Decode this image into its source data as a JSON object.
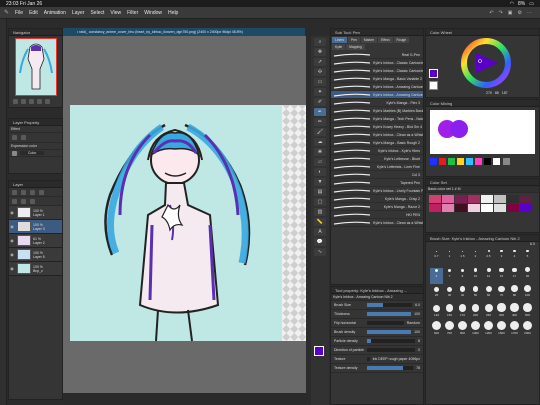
{
  "status": {
    "time": "23:03",
    "date": "Fri Jan 26",
    "battery": "8%"
  },
  "menu": [
    "File",
    "Edit",
    "Animation",
    "Layer",
    "Select",
    "View",
    "Filter",
    "Window",
    "Help"
  ],
  "doc_tab": "• raidi_ constancy_anime_cover_hhu (heart_by_kirboo_lionzen_dgn750.png) (2400 x 2400px 96dpi 48.8%)",
  "navigator": {
    "title": "Navigator"
  },
  "layer_property": {
    "title": "Layer Property",
    "effect": "Effect",
    "expression_color": "Expression color",
    "color_value": "Color"
  },
  "layers": {
    "title": "Layer",
    "items": [
      {
        "opacity": "100 %",
        "blend": "Normal",
        "name": "Layer 1"
      },
      {
        "opacity": "100 %",
        "blend": "Normal",
        "name": "Layer 3"
      },
      {
        "opacity": "61 %",
        "blend": "Normal",
        "name": "Layer 2"
      },
      {
        "opacity": "100 %",
        "blend": "Normal",
        "name": "Layer 5"
      },
      {
        "opacity": "100 %",
        "blend": "Normal",
        "name": "Bnp_z"
      }
    ]
  },
  "subtool": {
    "title": "Sub Tool: Pen",
    "tabs": [
      "Liners",
      "Pen",
      "Marker",
      "Effect",
      "Rough",
      "Kylie",
      "Mapping"
    ],
    "brushes": [
      "Real G-Pen",
      "Kyle's Inkbox - Classic Cartoonist",
      "Kyle's Inkbox - Classic Cartoonist 2",
      "Kyle's Manga - Basic Variable 2",
      "Kyle's Inkbox - Amazing Cartoon Nib",
      "Kyle's Inkbox - Amazing Cartoon Nib 2",
      "Kyle's Manga - Flex 3",
      "Kyle's Marbles (B) Marbles Basic",
      "Kyle's Manga - Tech Pens - Natural",
      "Kyle's Kosey Heavy - Blot Sm 4",
      "Kyle's Inkbox - Clean as a Whistle NEW 2",
      "Kyle's Manga - Basic Rough 2",
      "Kyle's Inkbox - Kyle's Hires",
      "Kyle's Lettreuse - Bluet",
      "Kyle's Letterists - Liner Fine",
      "Col 3",
      "Tapered Pen",
      "Kyle's Inkbox - Lively Fountain Pen 2",
      "Kyle's Manga - Crisp 2",
      "Kyle's Manga - Razor 2",
      "HKI PEN",
      "Kyle's Inkbox - Clean as a Whistle"
    ],
    "selected_index": 5
  },
  "tool_property": {
    "title": "Tool property: Kyle's Inkbox - Amazing ...",
    "brush_name": "Kyle's Inkbox - Amazing Cartoon Nib 2",
    "rows": [
      {
        "label": "Brush Size",
        "value": "6.0",
        "fill": 0.35
      },
      {
        "label": "Thickness",
        "value": "100",
        "fill": 1.0
      },
      {
        "label": "Flip horizontal",
        "value": "Random",
        "fill": 0
      },
      {
        "label": "Brush density",
        "value": "100",
        "fill": 1.0
      },
      {
        "label": "Particle density",
        "value": "8",
        "fill": 0.08
      },
      {
        "label": "Direction of particle",
        "value": "0",
        "fill": 0.0
      },
      {
        "label": "Texture",
        "value": "Ink DEEP rough paper 4096px",
        "fill": 0
      },
      {
        "label": "Texture density",
        "value": "78",
        "fill": 0.78
      }
    ]
  },
  "color_wheel": {
    "title": "Color Wheel",
    "h": "270",
    "s": "88",
    "v": "187"
  },
  "color_mixing": {
    "title": "Color Mixing"
  },
  "color_set": {
    "title": "Color Set",
    "set_name": "Basic color set 1 # M"
  },
  "brush_size": {
    "title": "Brush Size: Kyle's Inkbox - Amazing Cartoon Nib 2",
    "value": "6.0",
    "sizes": [
      "0.7",
      "1",
      "1.5",
      "2",
      "2.5",
      "3",
      "4",
      "5",
      "6",
      "7",
      "8",
      "10",
      "12",
      "15",
      "17",
      "20",
      "25",
      "30",
      "40",
      "50",
      "60",
      "70",
      "80",
      "100",
      "120",
      "150",
      "170",
      "200",
      "250",
      "300",
      "400",
      "500",
      "600",
      "700",
      "800",
      "1000",
      "1200",
      "1500",
      "1700",
      "2000"
    ]
  },
  "colors": {
    "accent": "#3d5a80",
    "canvas_bg": "#bfe7e4",
    "main_color": "#5a00c8",
    "sub_color": "#ffffff"
  }
}
